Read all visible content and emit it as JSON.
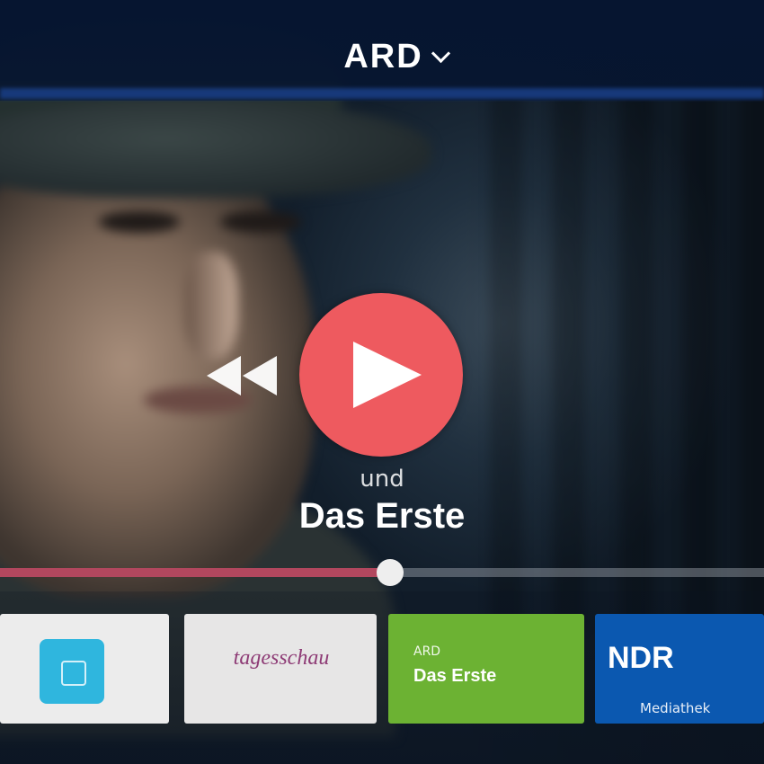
{
  "header": {
    "channel_name": "ARD",
    "chevron_icon": "chevron-down-icon"
  },
  "player": {
    "prefix_text": "und",
    "show_title": "Das Erste",
    "play_icon": "play-icon",
    "rewind_icon": "rewind-icon",
    "progress_fraction": 0.51,
    "accent_color": "#ee5a5f",
    "progress_color": "#b2475e"
  },
  "channel_tiles": [
    {
      "icon": "app-logo-icon",
      "color": "#2fb6de"
    },
    {
      "label": "tagesschau",
      "color": "#8e3c76"
    },
    {
      "small_label": "ARD",
      "label": "Das Erste",
      "color": "#6cb233"
    },
    {
      "label": "NDR",
      "small_label": "Mediathek",
      "color": "#0b58b0"
    }
  ]
}
